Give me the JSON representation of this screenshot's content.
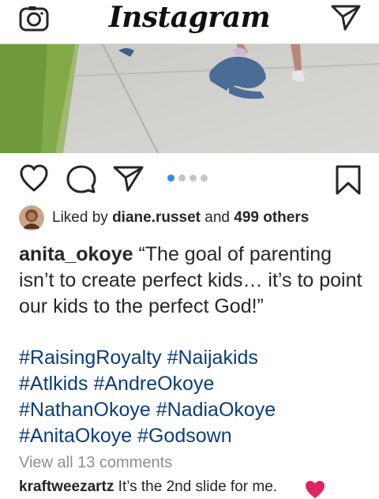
{
  "header": {
    "logo_text": "Instagram",
    "camera_icon": "camera-icon",
    "direct_icon": "paper-plane-icon"
  },
  "post": {
    "carousel": {
      "total": 4,
      "active_index": 0
    },
    "actions": [
      "heart-icon",
      "comment-bubble-icon",
      "share-plane-icon",
      "bookmark-icon"
    ],
    "likes": {
      "prefix": "Liked by ",
      "first_user": "diane.russet",
      "middle": " and ",
      "others": "499 others"
    },
    "caption": {
      "username": "anita_okoye",
      "text": " “The goal of parenting isn’t to create perfect kids… it’s to point our kids to the perfect God!”"
    },
    "hashtags": [
      "#RaisingRoyalty #Naijakids",
      "#Atlkids #AndreOkoye",
      "#NathanOkoye #NadiaOkoye",
      "#AnitaOkoye #Godsown"
    ],
    "view_comments": "View all 13 comments",
    "comment": {
      "username": "kraftweezartz",
      "text": " It’s the 2nd slide for me."
    }
  },
  "colors": {
    "hashtag": "#0b3d7a",
    "carousel_active": "#2f8fe8",
    "carousel_inactive": "#c6c6c6",
    "emoji_heart": "#e0245e"
  }
}
